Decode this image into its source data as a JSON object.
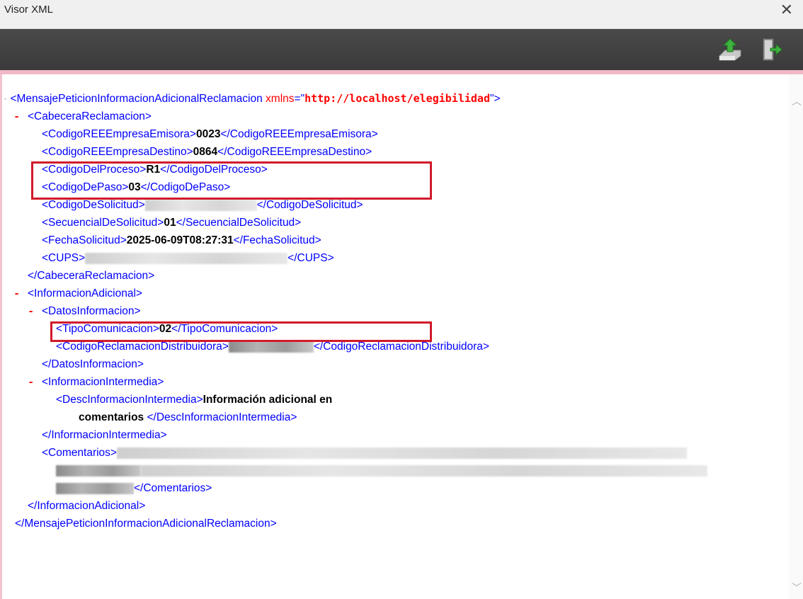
{
  "window": {
    "title": "Visor XML",
    "close_glyph": "✕"
  },
  "toolbar": {
    "export_icon": "export-icon",
    "exit_icon": "exit-door-icon"
  },
  "xml": {
    "root_open": "<MensajePeticionInformacionAdicionalReclamacion",
    "root_attr_name": "xmlns",
    "root_attr_eq": "=\"",
    "root_attr_value": "http://localhost/elegibilidad",
    "root_attr_close": "\">",
    "root_close": "</MensajePeticionInformacionAdicionalReclamacion>",
    "cabecera_open": "<CabeceraReclamacion>",
    "cabecera_close": "</CabeceraReclamacion>",
    "emisora_open": "<CodigoREEEmpresaEmisora>",
    "emisora_value": "0023",
    "emisora_close": "</CodigoREEEmpresaEmisora>",
    "destino_open": "<CodigoREEEmpresaDestino>",
    "destino_value": "0864",
    "destino_close": "</CodigoREEEmpresaDestino>",
    "proceso_open": "<CodigoDelProceso>",
    "proceso_value": "R1",
    "proceso_close": "</CodigoDelProceso>",
    "paso_open": "<CodigoDePaso>",
    "paso_value": "03",
    "paso_close": "</CodigoDePaso>",
    "solicitud_open": "<CodigoDeSolicitud>",
    "solicitud_close": "</CodigoDeSolicitud>",
    "secuencial_open": "<SecuencialDeSolicitud>",
    "secuencial_value": "01",
    "secuencial_close": "</SecuencialDeSolicitud>",
    "fecha_open": "<FechaSolicitud>",
    "fecha_value": "2025-06-09T08:27:31",
    "fecha_close": "</FechaSolicitud>",
    "cups_open": "<CUPS>",
    "cups_close": "</CUPS>",
    "info_open": "<InformacionAdicional>",
    "info_close": "</InformacionAdicional>",
    "datos_open": "<DatosInformacion>",
    "datos_close": "</DatosInformacion>",
    "tipo_open": "<TipoComunicacion>",
    "tipo_value": "02",
    "tipo_close": "</TipoComunicacion>",
    "recl_open": "<CodigoReclamacionDistribuidora>",
    "recl_close": "</CodigoReclamacionDistribuidora>",
    "inter_open": "<InformacionIntermedia>",
    "inter_close": "</InformacionIntermedia>",
    "desc_open": "<DescInformacionIntermedia>",
    "desc_value_1": "Información adicional en",
    "desc_value_2": "comentarios",
    "desc_close": "</DescInformacionIntermedia>",
    "coment_open": "<Comentarios>",
    "coment_close": "</Comentarios>",
    "minus": "-"
  }
}
